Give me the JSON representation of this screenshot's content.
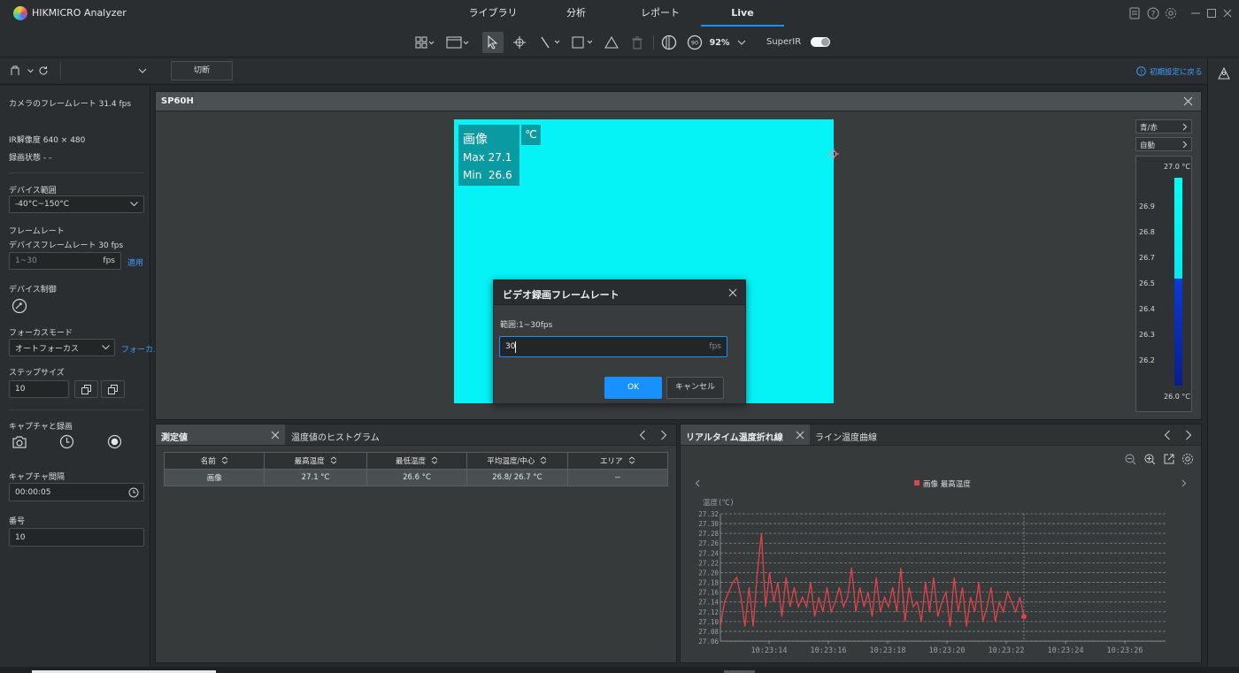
{
  "app": {
    "title": "HIKMICRO Analyzer"
  },
  "nav": {
    "tabs": [
      "ライブラリ",
      "分析",
      "レポート",
      "Live"
    ],
    "active": "Live"
  },
  "toolbar": {
    "zoom": "92%",
    "superir_label": "SuperIR",
    "superir_on": true
  },
  "subbar": {
    "cut_label": "切断",
    "reset_label": "初期設定に戻る"
  },
  "left": {
    "frame_rate": "カメラのフレームレート 31.4 fps",
    "ir_resolution": "IR解像度 640 × 480",
    "record_status": "録画状態 - -",
    "device_range_label": "デバイス範囲",
    "device_range_value": "-40°C~150°C",
    "framerate_label": "フレームレート",
    "device_framerate": "デバイスフレームレート 30 fps",
    "fps_placeholder": "1~30",
    "fps_unit": "fps",
    "apply_label": "適用",
    "device_control_label": "デバイス制御",
    "focus_mode_label": "フォーカスモード",
    "focus_mode_value": "オートフォーカス",
    "focus_link": "フォーカス",
    "step_size_label": "ステップサイズ",
    "step_size_value": "10",
    "capture_label": "キャプチャと録画",
    "capture_interval_label": "キャプチャ間隔",
    "capture_interval_value": "00:00:05",
    "number_label": "番号",
    "number_value": "10"
  },
  "device_panel": {
    "title": "SP60H",
    "overlay": {
      "title": "画像",
      "unit": "℃",
      "max": "Max 27.1",
      "min": "Min  26.6"
    },
    "palette_label": "青/赤",
    "mode_label": "自動",
    "scale": {
      "top": "27.0 °C",
      "bottom": "26.0 °C",
      "ticks": [
        "26.9",
        "26.8",
        "26.7",
        "26.5",
        "26.4",
        "26.3",
        "26.2"
      ],
      "level": 0.4
    }
  },
  "dialog": {
    "title": "ビデオ録画フレームレート",
    "range": "範囲:1~30fps",
    "value": "30",
    "unit": "fps",
    "ok": "OK",
    "cancel": "キャンセル"
  },
  "measure_panel": {
    "tabs": [
      "測定値",
      "温度値のヒストグラム"
    ],
    "columns": [
      "名前",
      "最高温度",
      "最低温度",
      "平均温度/中心",
      "エリア"
    ],
    "rows": [
      [
        "画像",
        "27.1 °C",
        "26.6 °C",
        "26.8/ 26.7 °C",
        "--"
      ]
    ]
  },
  "chart_panel": {
    "tabs": [
      "リアルタイム温度折れ線",
      "ライン温度曲線"
    ],
    "legend": "画像 最高温度",
    "y_title": "温度(℃)"
  },
  "chart_data": {
    "type": "line",
    "ylabel": "温度(℃)",
    "ylim": [
      27.06,
      27.32
    ],
    "yticks": [
      "27.32",
      "27.30",
      "27.28",
      "27.26",
      "27.24",
      "27.22",
      "27.20",
      "27.18",
      "27.16",
      "27.14",
      "27.12",
      "27.10",
      "27.08",
      "27.06"
    ],
    "xticks": [
      "10:23:14",
      "10:23:16",
      "10:23:18",
      "10:23:20",
      "10:23:22",
      "10:23:24",
      "10:23:26"
    ],
    "series": [
      {
        "name": "画像 最高温度",
        "color": "#e0434b",
        "values": [
          27.09,
          27.14,
          27.16,
          27.18,
          27.19,
          27.15,
          27.09,
          27.17,
          27.09,
          27.2,
          27.28,
          27.13,
          27.2,
          27.14,
          27.18,
          27.11,
          27.19,
          27.13,
          27.17,
          27.13,
          27.15,
          27.13,
          27.18,
          27.11,
          27.15,
          27.12,
          27.17,
          27.12,
          27.14,
          27.17,
          27.13,
          27.15,
          27.21,
          27.12,
          27.17,
          27.13,
          27.16,
          27.11,
          27.19,
          27.12,
          27.15,
          27.13,
          27.17,
          27.12,
          27.21,
          27.1,
          27.17,
          27.13,
          27.14,
          27.1,
          27.18,
          27.12,
          27.19,
          27.11,
          27.14,
          27.16,
          27.09,
          27.19,
          27.12,
          27.17,
          27.09,
          27.15,
          27.12,
          27.18,
          27.1,
          27.13,
          27.17,
          27.1,
          27.14,
          27.12,
          27.16,
          27.14,
          27.12,
          27.15,
          27.11
        ]
      }
    ]
  },
  "colors": {
    "accent": "#1890ff",
    "thermal": "#05f2f6",
    "alarm": "#e0434b"
  }
}
